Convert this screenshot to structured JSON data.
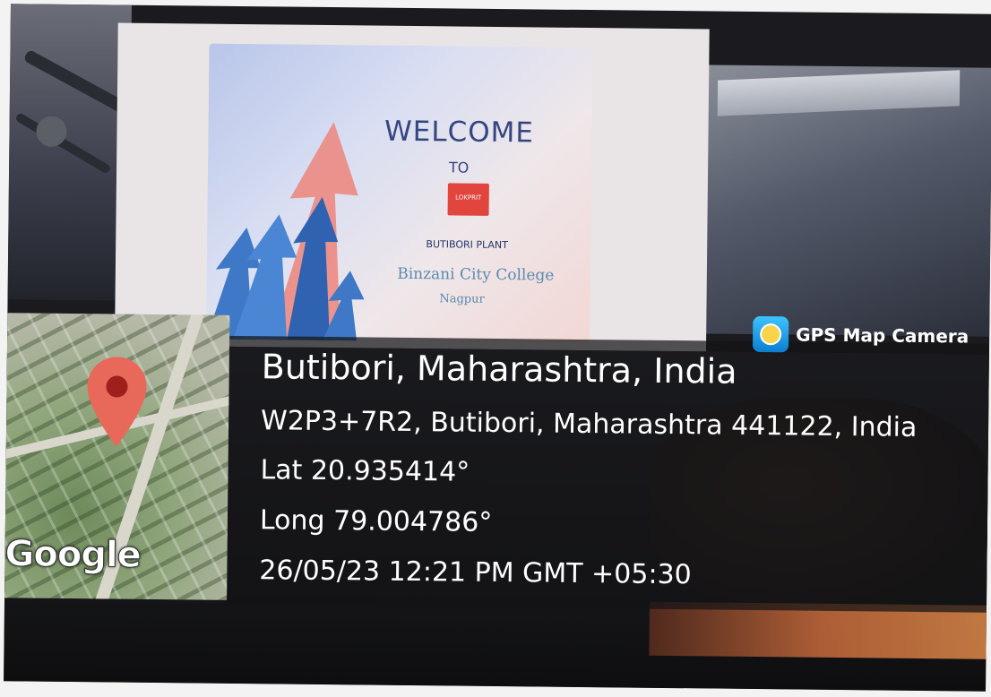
{
  "slide": {
    "welcome": "WELCOME",
    "to": "TO",
    "logo_text": "LOKPRIT",
    "plant": "BUTIBORI PLANT",
    "college": "Binzani City College",
    "city": "Nagpur"
  },
  "overlay": {
    "app_name": "GPS Map Camera",
    "location_title": "Butibori, Maharashtra, India",
    "address": "W2P3+7R2, Butibori, Maharashtra 441122, India",
    "latitude": "Lat 20.935414°",
    "longitude": "Long 79.004786°",
    "timestamp": "26/05/23 12:21 PM GMT +05:30",
    "map_brand": "Google"
  },
  "colors": {
    "pin": "#e8685a",
    "panel_bg": "#141416",
    "slide_title": "#344580",
    "app_icon": "#1a9be6"
  },
  "icons": [
    "map-pin-icon",
    "gps-map-camera-app-icon"
  ]
}
